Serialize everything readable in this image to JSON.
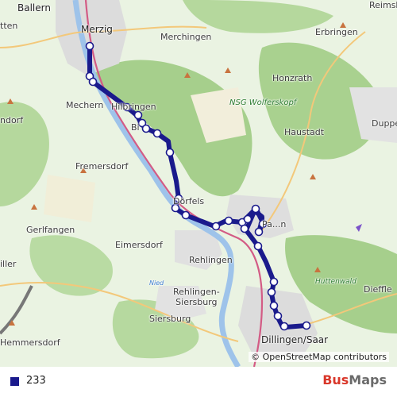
{
  "map": {
    "place_labels": {
      "ballern": "Ballern",
      "merzig": "Merzig",
      "merchingen": "Merchingen",
      "reimsbach": "Reimsb",
      "erbringen": "Erbringen",
      "honzrath": "Honzrath",
      "nsg": "NSG Wolferskopf",
      "haustadt": "Haustadt",
      "duppenweiler": "Duppe",
      "mechern": "Mechern",
      "hilbringen": "Hilbringen",
      "bietzen": "Bi",
      "fremersdorf": "Fremersdorf",
      "siersdorf": "ndorf",
      "gerlfangen": "Gerlfangen",
      "eimersdorf": "Eimersdorf",
      "rehlingen": "Rehlingen",
      "niedaue": "Nied",
      "rehlingen_siersburg": "Rehlingen-\nSiersburg",
      "siersburg": "Siersburg",
      "hemmersdorf": "Hemmersdorf",
      "dillingen": "Dillingen/Saar",
      "huttenwald": "Huttenwald",
      "diefflen": "Dieffle",
      "pachten": "Pa...n",
      "dorfels": "Dörfels",
      "brotdorf": "tten",
      "biller": "iller"
    },
    "attribution": "© OpenStreetMap contributors",
    "route_color": "#1a1a8c"
  },
  "legend": {
    "route_label": "233"
  },
  "brand": {
    "part1": "Bus",
    "part2": "Maps"
  }
}
